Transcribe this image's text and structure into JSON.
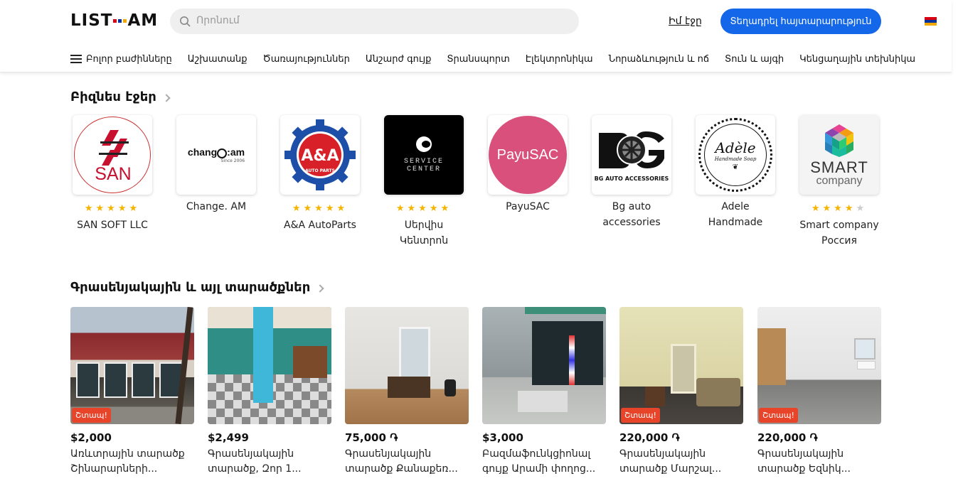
{
  "header": {
    "logo": "LIST.AM",
    "search_placeholder": "Որոնում",
    "my_page": "Իմ էջը",
    "post_button": "Տեղադրել հայտարարություն",
    "flag_colors": [
      "#d90012",
      "#0033a0",
      "#f2a800"
    ]
  },
  "nav": {
    "items": [
      "Բոլոր բաժինները",
      "Աշխատանք",
      "Ծառայություններ",
      "Անշարժ գույք",
      "Տրանսպորտ",
      "Էլեկտրոնիկա",
      "Նորաձևություն և ոճ",
      "Տուն և այգի",
      "Կենցաղային տեխնիկա"
    ]
  },
  "business": {
    "title": "Բիզնես էջեր",
    "items": [
      {
        "name_lines": [
          "SAN SOFT LLC"
        ],
        "rating": 5,
        "logo_text": "SAN"
      },
      {
        "name_lines": [
          "Change. AM"
        ],
        "rating": 0,
        "logo_text": "chang",
        "logo_text2": "am",
        "logo_sub": "Since 2006"
      },
      {
        "name_lines": [
          "A&A AutoParts"
        ],
        "rating": 5,
        "logo_text": "A&A",
        "logo_sub": "AUTO PARTS"
      },
      {
        "name_lines": [
          "Սերվիս",
          "Կենտրոն"
        ],
        "rating": 5,
        "logo_text": "SERVICE",
        "logo_sub": "CENTER"
      },
      {
        "name_lines": [
          "PayuSAC"
        ],
        "rating": 0,
        "logo_text": "PayuSAC"
      },
      {
        "name_lines": [
          "Bg auto",
          "accessories"
        ],
        "rating": 0,
        "logo_text": "BG AUTO ACCESSORIES"
      },
      {
        "name_lines": [
          "Adele",
          "Handmade"
        ],
        "rating": 0,
        "logo_text": "Adèle",
        "logo_sub": "Handmade Soap"
      },
      {
        "name_lines": [
          "Smart company",
          "Россия"
        ],
        "rating": 4,
        "logo_text": "SMART",
        "logo_sub": "company"
      }
    ]
  },
  "listings": {
    "title": "Գրասենյակային և այլ տարածքներ",
    "badge": "Շտապ!",
    "items": [
      {
        "price": "$2,000",
        "title_lines": [
          "Առևտրային տարածք",
          "Շինարարների..."
        ],
        "urgent": true
      },
      {
        "price": "$2,499",
        "title_lines": [
          "Գրասենյակային",
          "տարածք, Զոր 1..."
        ],
        "urgent": false
      },
      {
        "price": "75,000 ֏",
        "title_lines": [
          "Գրասենյակային",
          "տարածք Քանաքեռ..."
        ],
        "urgent": false
      },
      {
        "price": "$3,000",
        "title_lines": [
          "Բազմաֆունկցիոնալ",
          "գույք Արամի փողոց..."
        ],
        "urgent": false
      },
      {
        "price": "220,000 ֏",
        "title_lines": [
          "Գրասենյակային",
          "տարածք Մարշալ..."
        ],
        "urgent": true
      },
      {
        "price": "220,000 ֏",
        "title_lines": [
          "Գրասենյակային",
          "տարածք Եզնիկ..."
        ],
        "urgent": true
      }
    ]
  }
}
